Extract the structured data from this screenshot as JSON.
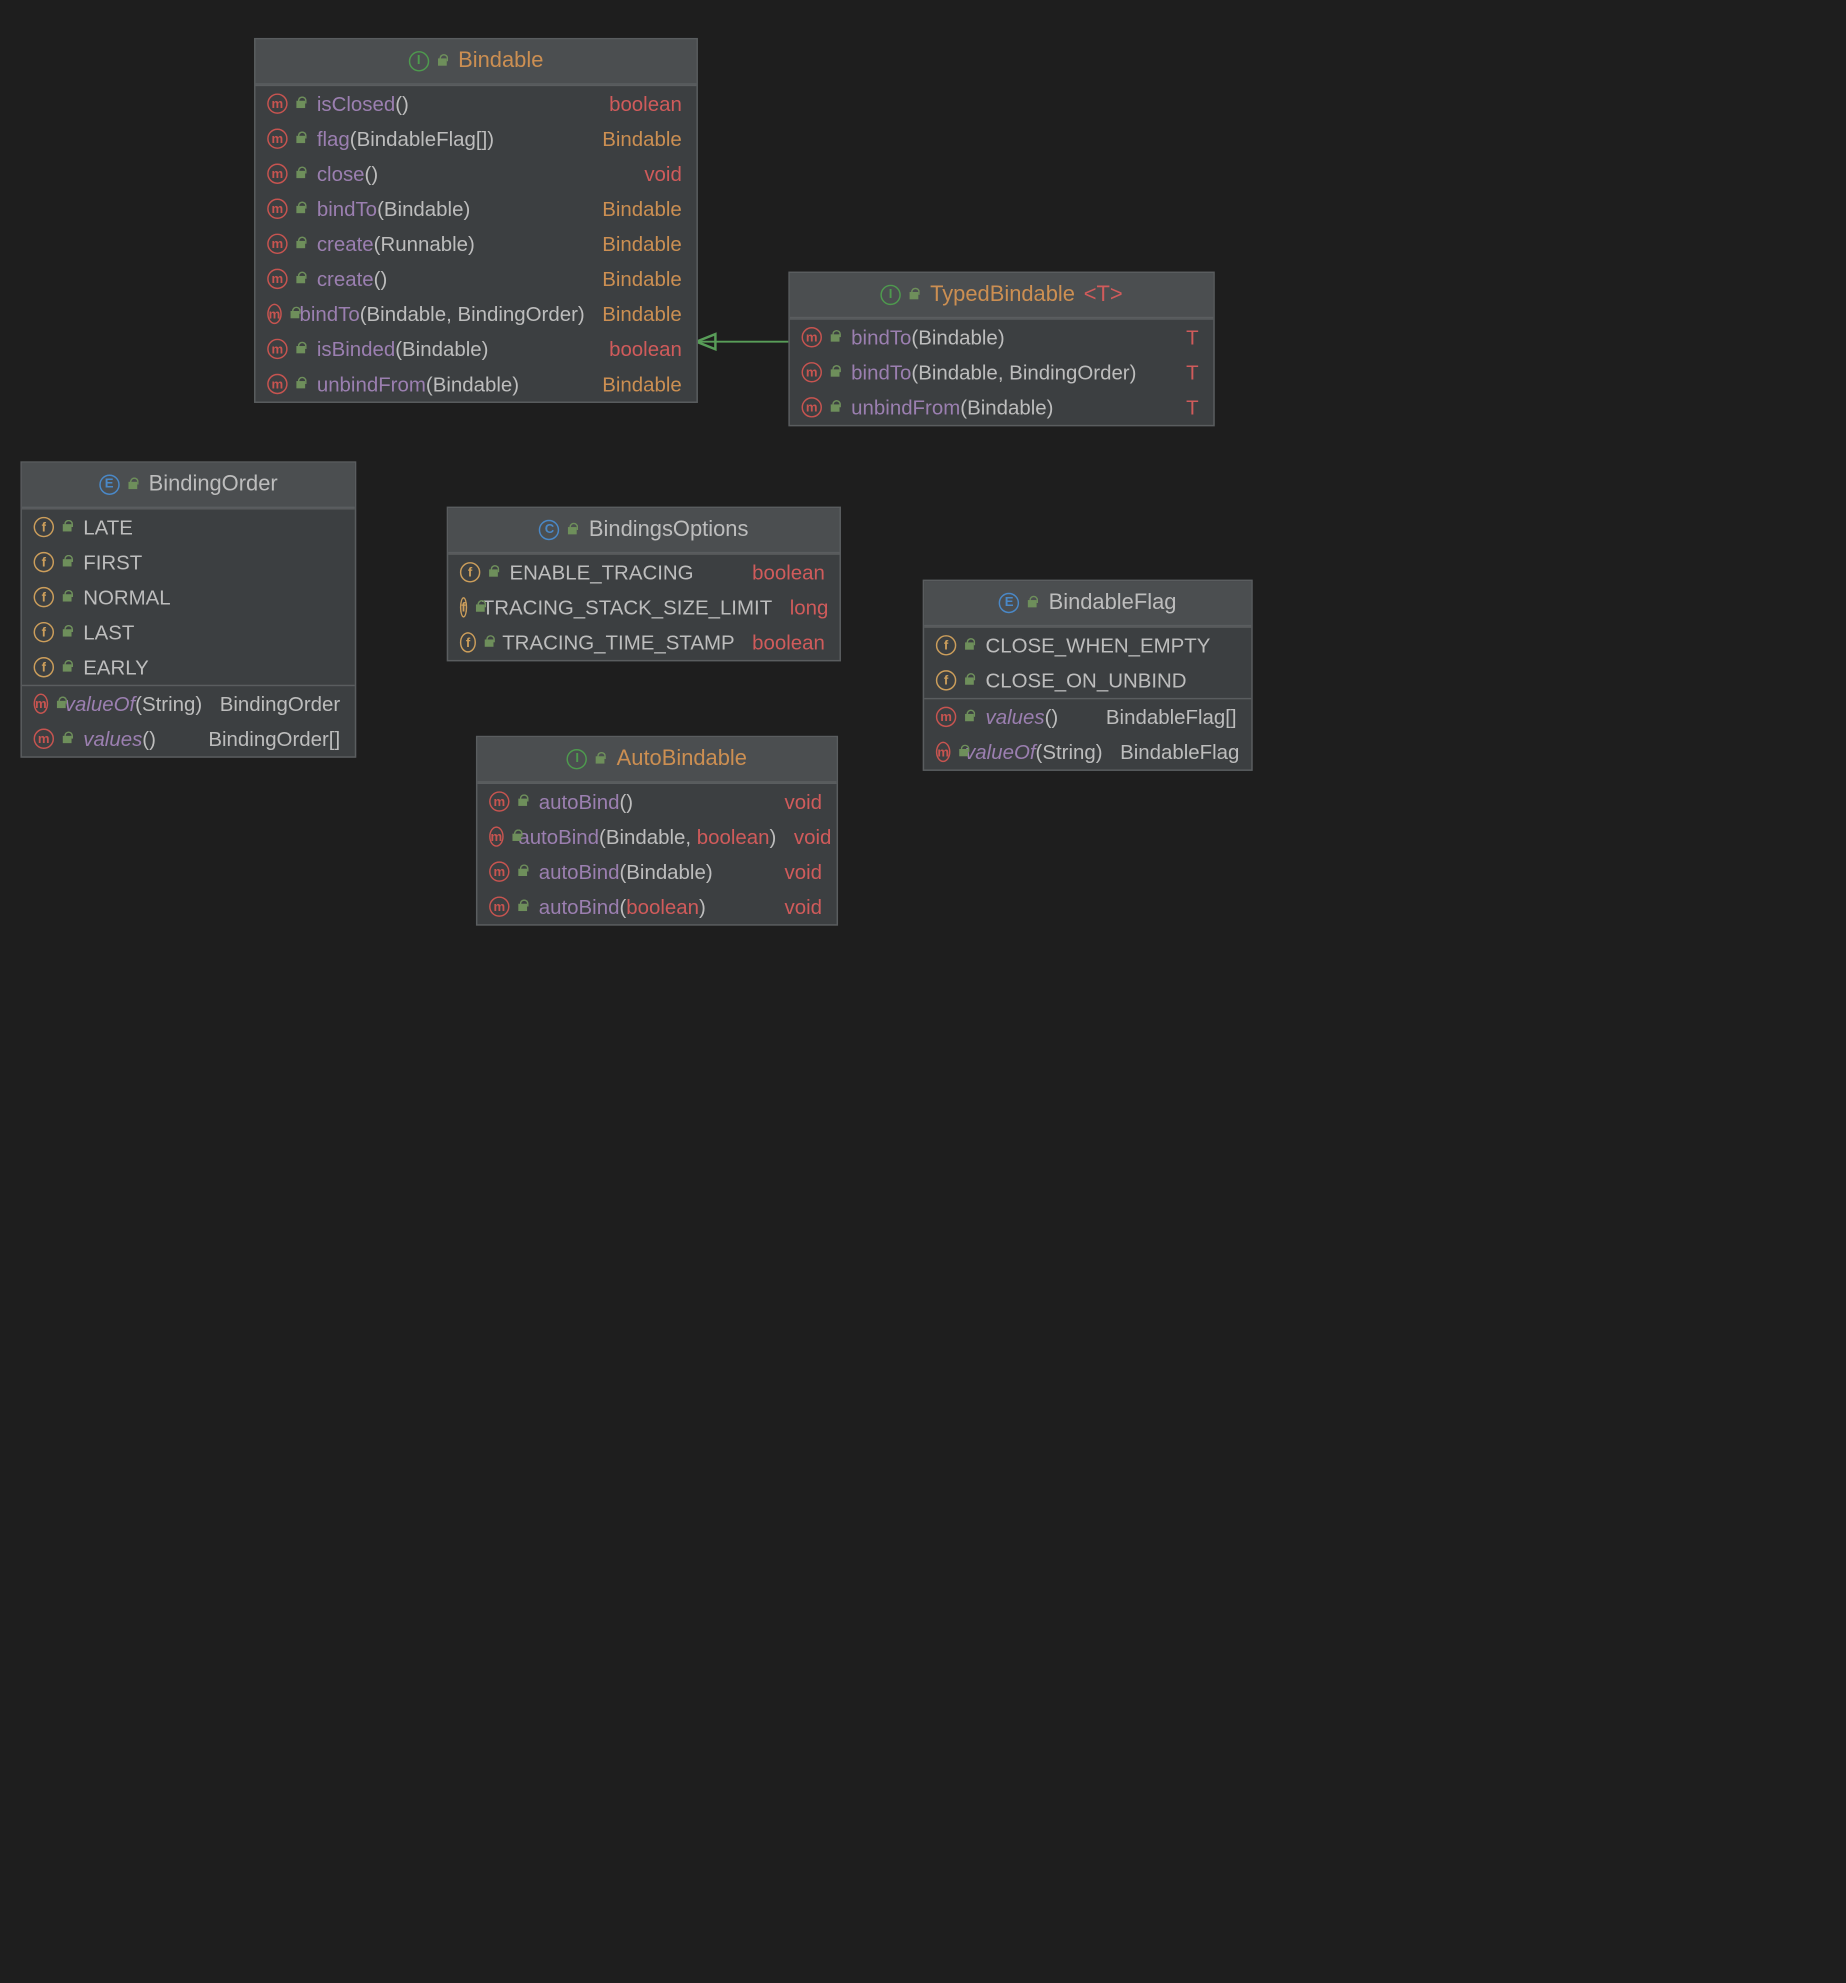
{
  "classes": {
    "bindable": {
      "kind": "I",
      "name": "Bindable",
      "methods": [
        {
          "name": "isClosed",
          "params": [],
          "ret": "boolean",
          "retKind": "kw"
        },
        {
          "name": "flag",
          "params": [
            {
              "t": "BindableFlag[]"
            }
          ],
          "ret": "Bindable",
          "retKind": "type"
        },
        {
          "name": "close",
          "params": [],
          "ret": "void",
          "retKind": "kw"
        },
        {
          "name": "bindTo",
          "params": [
            {
              "t": "Bindable"
            }
          ],
          "ret": "Bindable",
          "retKind": "type"
        },
        {
          "name": "create",
          "params": [
            {
              "t": "Runnable"
            }
          ],
          "ret": "Bindable",
          "retKind": "type"
        },
        {
          "name": "create",
          "params": [],
          "ret": "Bindable",
          "retKind": "type"
        },
        {
          "name": "bindTo",
          "params": [
            {
              "t": "Bindable"
            },
            {
              "t": "BindingOrder"
            }
          ],
          "ret": "Bindable",
          "retKind": "type"
        },
        {
          "name": "isBinded",
          "params": [
            {
              "t": "Bindable"
            }
          ],
          "ret": "boolean",
          "retKind": "kw"
        },
        {
          "name": "unbindFrom",
          "params": [
            {
              "t": "Bindable"
            }
          ],
          "ret": "Bindable",
          "retKind": "type"
        }
      ]
    },
    "typedBindable": {
      "kind": "I",
      "name": "TypedBindable",
      "typeParam": "<T>",
      "methods": [
        {
          "name": "bindTo",
          "params": [
            {
              "t": "Bindable"
            }
          ],
          "ret": "T",
          "retKind": "kw"
        },
        {
          "name": "bindTo",
          "params": [
            {
              "t": "Bindable"
            },
            {
              "t": "BindingOrder"
            }
          ],
          "ret": "T",
          "retKind": "kw"
        },
        {
          "name": "unbindFrom",
          "params": [
            {
              "t": "Bindable"
            }
          ],
          "ret": "T",
          "retKind": "kw"
        }
      ]
    },
    "bindingOrder": {
      "kind": "E",
      "name": "BindingOrder",
      "fields": [
        {
          "name": "LATE"
        },
        {
          "name": "FIRST"
        },
        {
          "name": "NORMAL"
        },
        {
          "name": "LAST"
        },
        {
          "name": "EARLY"
        }
      ],
      "methods": [
        {
          "name": "valueOf",
          "italic": true,
          "params": [
            {
              "t": "String"
            }
          ],
          "ret": "BindingOrder",
          "retKind": "plain"
        },
        {
          "name": "values",
          "italic": true,
          "params": [],
          "ret": "BindingOrder[]",
          "retKind": "plain"
        }
      ]
    },
    "bindingsOptions": {
      "kind": "C",
      "name": "BindingsOptions",
      "fields": [
        {
          "name": "ENABLE_TRACING",
          "ret": "boolean",
          "retKind": "kw"
        },
        {
          "name": "TRACING_STACK_SIZE_LIMIT",
          "ret": "long",
          "retKind": "kw"
        },
        {
          "name": "TRACING_TIME_STAMP",
          "ret": "boolean",
          "retKind": "kw"
        }
      ]
    },
    "bindableFlag": {
      "kind": "E",
      "name": "BindableFlag",
      "fields": [
        {
          "name": "CLOSE_WHEN_EMPTY"
        },
        {
          "name": "CLOSE_ON_UNBIND"
        }
      ],
      "methods": [
        {
          "name": "values",
          "italic": true,
          "params": [],
          "ret": "BindableFlag[]",
          "retKind": "plain"
        },
        {
          "name": "valueOf",
          "italic": true,
          "params": [
            {
              "t": "String"
            }
          ],
          "ret": "BindableFlag",
          "retKind": "plain"
        }
      ]
    },
    "autoBindable": {
      "kind": "I",
      "name": "AutoBindable",
      "methods": [
        {
          "name": "autoBind",
          "params": [],
          "ret": "void",
          "retKind": "kw"
        },
        {
          "name": "autoBind",
          "params": [
            {
              "t": "Bindable"
            },
            {
              "t": "boolean",
              "kw": true
            }
          ],
          "ret": "void",
          "retKind": "kw"
        },
        {
          "name": "autoBind",
          "params": [
            {
              "t": "Bindable"
            }
          ],
          "ret": "void",
          "retKind": "kw"
        },
        {
          "name": "autoBind",
          "params": [
            {
              "t": "boolean",
              "kw": true
            }
          ],
          "ret": "void",
          "retKind": "kw"
        }
      ]
    }
  },
  "relations": [
    {
      "from": "typedBindable",
      "to": "bindable",
      "kind": "generalization"
    }
  ]
}
